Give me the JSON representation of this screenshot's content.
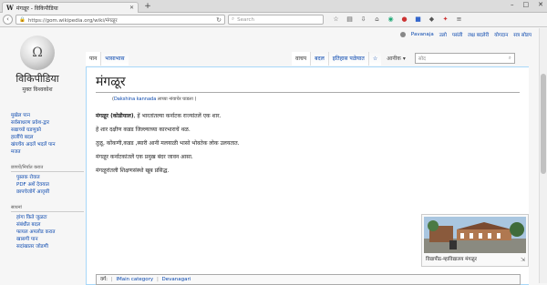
{
  "browser": {
    "tab_title": "मंगळूर - विकिपीडिया",
    "tab_favicon": "W",
    "new_tab": "+",
    "url": "https://gom.wikipedia.org/wiki/मंगळूर",
    "search_placeholder": "Search"
  },
  "personal": {
    "username": "Pavanaja",
    "links": [
      "उलो",
      "पसंती",
      "लक्ष बदलेरी",
      "योगदान",
      "सत्र सोडप"
    ]
  },
  "logo": {
    "glyph": "Ω",
    "title": "विकिपीडिया",
    "tagline": "मुक्त विश्वकोश"
  },
  "sidebar": {
    "nav": [
      "मुखेल पान",
      "सर्वसाधरण प्रवेश-द्वार",
      "सद्याच्यो घडणुको",
      "हालींचे बदल",
      "खंयचेंय अदलें भदलें पान",
      "मजत"
    ],
    "print_head": "छापचें/निर्यात करात",
    "print": [
      "पुस्तक रोवात",
      "PDF अशें देवयात",
      "छापचेजोगें आवृत्ती"
    ],
    "tools_head": "साधनां",
    "tools": [
      "हांगा किते जुळटा",
      "संबंधीत बदल",
      "फायल अपलोड करात",
      "खासगी पान",
      "सदांखातर जोडणी"
    ]
  },
  "tabs": {
    "left": [
      "पान",
      "भासाभास"
    ],
    "right": [
      "वाचप",
      "बदल",
      "इतिहास पळेयात"
    ],
    "more": "आनीक",
    "search_placeholder": "सोद"
  },
  "article": {
    "title": "मंगळूर",
    "hatnote_link": "Dakshina kannada",
    "hatnote_rest": " लाच्या नांवाचेर घाडला )",
    "bold_name": "मंगळूर (कोडीयाल)",
    "p1": ", हें भारतांतल्या कर्नाटक राज्यांतलें एक शार.",
    "p2": "हें शार दक्षीण कन्नड जिल्ल्याच्या कारभाराचें थळ.",
    "p3": "तुळू, कोंकणी,कन्नड ,ब्यारी आनी मलयाळी भासो भोवतेक लोक उलयतात.",
    "p4": "मंगळूर कर्नाटकांतलें एक प्रमुख बंदर जावन आसा.",
    "p5": "मंगळूरांतली शिक्षणसंस्थो खूब प्रसिद्ध."
  },
  "thumb": {
    "caption": "विद्यापीठ-म्हाविद्यालय मंगळूर"
  },
  "categories": {
    "label": "वर्ग:",
    "items": [
      "IMain category",
      "Devanagari"
    ]
  }
}
